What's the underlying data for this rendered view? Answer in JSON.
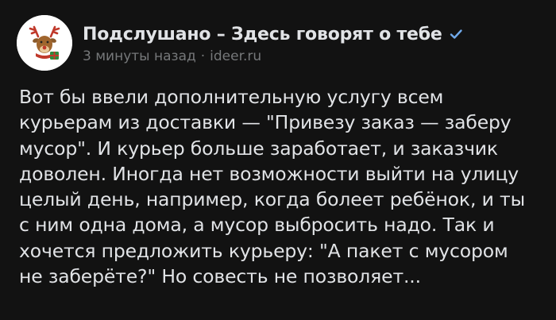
{
  "post": {
    "community_name": "Подслушано – Здесь говорят о тебе",
    "verified": true,
    "time_ago": "3 минуты назад",
    "separator": "·",
    "source": "ideer.ru",
    "text_lines": [
      "Вот бы ввели дополнительную услугу всем",
      "курьерам из доставки — \"Привезу заказ — заберу",
      "мусор\". И курьер больше заработает, и заказчик",
      "доволен. Иногда нет возможности выйти на улицу",
      "целый день, например, когда болеет ребёнок, и ты",
      "с ним одна дома, а мусор выбросить надо. Так и",
      "хочется предложить курьеру: \"А пакет с мусором",
      "не заберёте?\" Но совесть не позволяет..."
    ]
  },
  "colors": {
    "background": "#121212",
    "text": "#e1e3e6",
    "secondary_text": "#76787a",
    "verified_badge": "#71aaeb"
  },
  "icons": {
    "avatar": "reindeer-logo",
    "verified": "verified-check-icon"
  }
}
